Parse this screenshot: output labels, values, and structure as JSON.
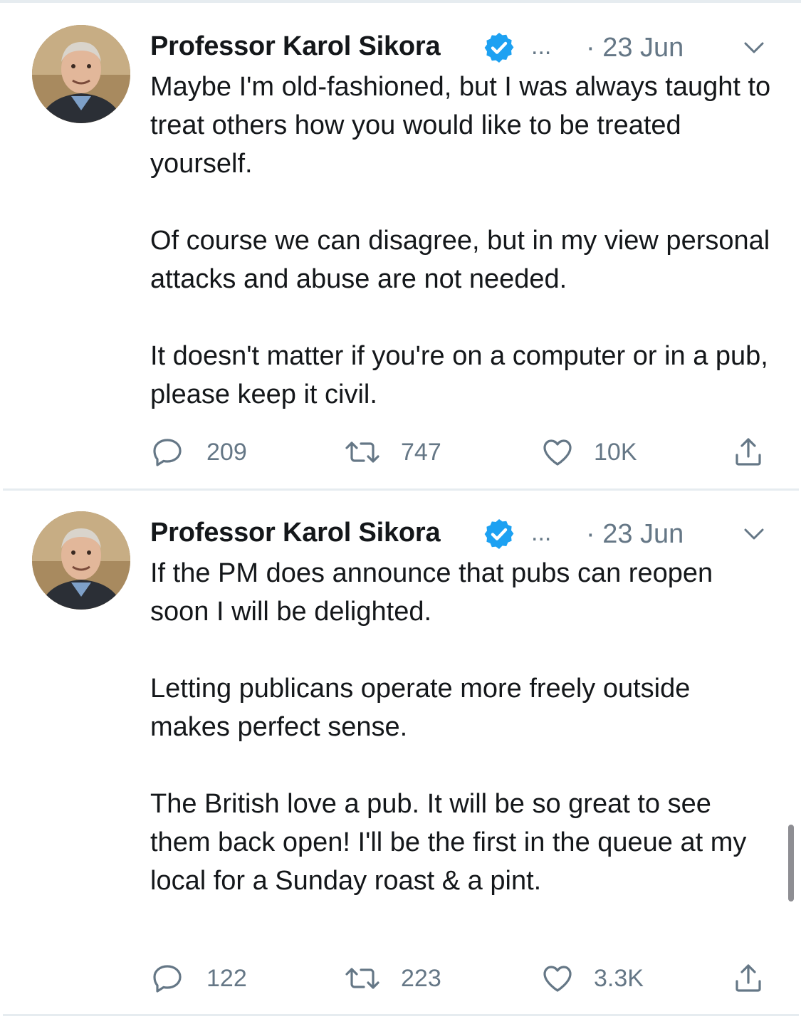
{
  "tweets": [
    {
      "author": "Professor Karol Sikora",
      "ellipsis": "...",
      "date": "· 23 Jun",
      "paragraphs": [
        "Maybe I'm old-fashioned, but I was always taught to treat others how you would like to be treated yourself.",
        "Of course we can disagree, but in my view personal attacks and abuse are not needed.",
        "It doesn't matter if you're on a computer or in a pub, please keep it civil."
      ],
      "replies": "209",
      "retweets": "747",
      "likes": "10K"
    },
    {
      "author": "Professor Karol Sikora",
      "ellipsis": "...",
      "date": "· 23 Jun",
      "paragraphs": [
        "If the PM does announce that pubs can reopen soon I will be delighted.",
        "Letting publicans operate more freely outside makes perfect sense.",
        "The British love a pub. It will be so great to see them back open! I'll be the first in the queue at my local for a Sunday roast & a pint."
      ],
      "replies": "122",
      "retweets": "223",
      "likes": "3.3K"
    }
  ],
  "colors": {
    "verified": "#1da1f2",
    "secondary_text": "#657786",
    "divider": "#e6ecf0"
  },
  "icons": [
    "verified-badge-icon",
    "chevron-down-icon",
    "reply-icon",
    "retweet-icon",
    "like-icon",
    "share-icon"
  ]
}
